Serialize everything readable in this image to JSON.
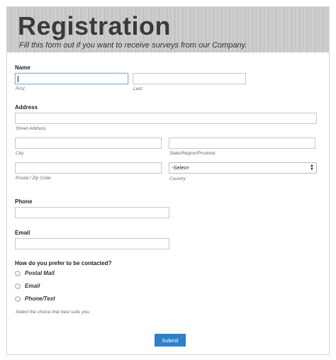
{
  "header": {
    "title": "Registration",
    "subtitle": "Fill this form out if you want to receive surveys from our Company."
  },
  "name": {
    "label": "Name",
    "first_sublabel": "First",
    "last_sublabel": "Last",
    "first_value": "",
    "last_value": ""
  },
  "address": {
    "label": "Address",
    "street_sublabel": "Street Address",
    "city_sublabel": "City",
    "state_sublabel": "State/Region/Province",
    "zip_sublabel": "Postal / Zip Code",
    "country_sublabel": "Country",
    "country_selected": "-Select-"
  },
  "phone": {
    "label": "Phone",
    "value": ""
  },
  "email": {
    "label": "Email",
    "value": ""
  },
  "contact": {
    "question": "How do you prefer to be contacted?",
    "options": [
      "Postal Mail",
      "Email",
      "Phone/Text"
    ],
    "hint": "Select the choice that best suits you."
  },
  "submit_label": "Submit",
  "colors": {
    "submit_bg": "#2f7fc9",
    "focus_border": "#7fb5e6",
    "header_bg": "#c9c9c9"
  }
}
